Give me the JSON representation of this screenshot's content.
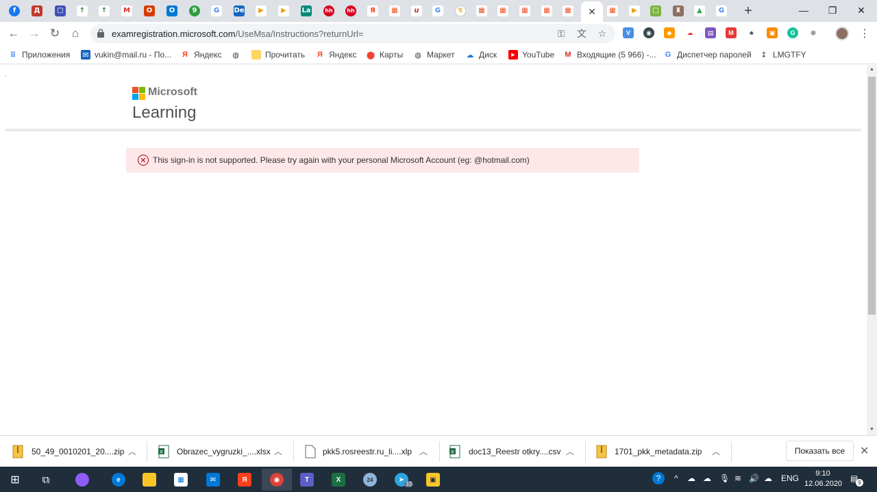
{
  "browser": {
    "url_host": "examregistration.microsoft.com",
    "url_path": "/UseMsa/Instructions?returnUrl=",
    "tabs": [
      "f",
      "Д",
      "▢",
      "↑",
      "↑",
      "M",
      "О",
      "O",
      "9",
      "G",
      "De",
      "▶",
      "▶",
      "La",
      "hh",
      "hh",
      "Я",
      "▦",
      "u",
      "G",
      "↯",
      "▦",
      "▦",
      "▦",
      "▦",
      "▦"
    ],
    "after_active_tabs": [
      "▦",
      "▶",
      "□",
      "♜",
      "▲",
      "G"
    ],
    "new_tab": "+",
    "extensions": [
      "V",
      "◉",
      "◆",
      "☁",
      "▤",
      "M",
      "♣",
      "▣",
      "G",
      "⬢"
    ]
  },
  "bookmarks": [
    {
      "icon": "apps-icon",
      "label": "Приложения"
    },
    {
      "icon": "mail-icon",
      "label": "vukin@mail.ru - По..."
    },
    {
      "icon": "yandex-icon",
      "label": "Яндекс"
    },
    {
      "icon": "globe-icon",
      "label": ""
    },
    {
      "icon": "bookmark-folder-icon",
      "label": "Прочитать"
    },
    {
      "icon": "yandex-icon",
      "label": "Яндекс"
    },
    {
      "icon": "maps-icon",
      "label": "Карты"
    },
    {
      "icon": "globe-icon",
      "label": "Маркет"
    },
    {
      "icon": "disk-icon",
      "label": "Диск"
    },
    {
      "icon": "youtube-icon",
      "label": "YouTube"
    },
    {
      "icon": "gmail-icon",
      "label": "Входящие (5 966) -..."
    },
    {
      "icon": "google-icon",
      "label": "Диспетчер паролей"
    },
    {
      "icon": "lmgtfy-icon",
      "label": "LMGTFY"
    }
  ],
  "page": {
    "brand": "Microsoft",
    "title": "Learning",
    "alert_text": "This sign-in is not supported. Please try again with your personal Microsoft Account (eg: @hotmail.com)",
    "dot": "."
  },
  "downloads": [
    {
      "name": "50_49_0010201_20....zip",
      "type": "zip"
    },
    {
      "name": "Obrazec_vygruzki_....xlsx",
      "type": "xlsx"
    },
    {
      "name": "pkk5.rosreestr.ru_li....xlp",
      "type": "file"
    },
    {
      "name": "doc13_Reestr otkry....csv",
      "type": "xlsx"
    },
    {
      "name": "1701_pkk_metadata.zip",
      "type": "zip"
    }
  ],
  "show_all_label": "Показать все",
  "taskbar": {
    "language": "ENG",
    "time": "9:10",
    "date": "12.06.2020",
    "notifications": "9",
    "telegram_badge": "33",
    "clock_badge": "24"
  },
  "colors": {
    "alert_bg": "#fde7e9",
    "alert_icon": "#a80000",
    "taskbar_bg": "#202d3a"
  }
}
